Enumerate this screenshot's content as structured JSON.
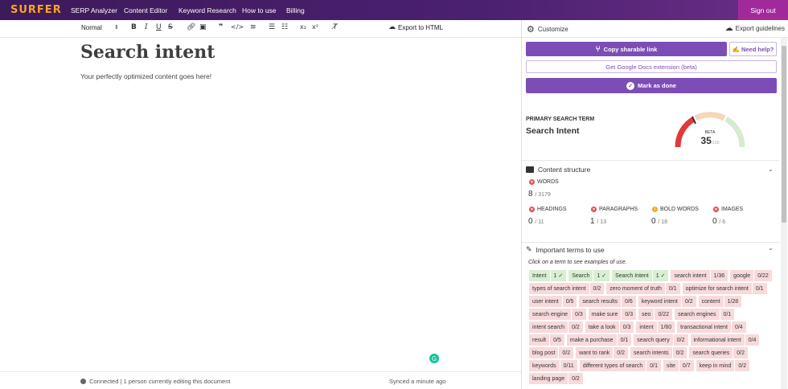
{
  "topbar": {
    "logo": "SURFER",
    "nav": [
      "SERP Analyzer",
      "Content Editor",
      "Keyword Research",
      "How to use",
      "Billing"
    ],
    "signout": "Sign out"
  },
  "toolbar": {
    "style_select": "Normal",
    "export_label": "Export to HTML"
  },
  "editor": {
    "title": "Search intent",
    "body": "Your perfectly optimized content goes here!"
  },
  "status": {
    "connection": "Connected | 1 person currently editing this document",
    "synced": "Synced a minute ago"
  },
  "panel": {
    "customize": "Customize",
    "export_guidelines": "Export guidelines",
    "copy_link": "Copy sharable link",
    "need_help": "Need help?",
    "gdocs": "Get Google Docs extension (beta)",
    "mark_done": "Mark as done",
    "primary_label": "PRIMARY SEARCH TERM",
    "primary_value": "Search Intent",
    "gauge": {
      "badge": "BETA",
      "score": "35",
      "max": "/100",
      "score_fraction": 0.35
    },
    "structure": {
      "title": "Content structure",
      "words_label": "WORDS",
      "words_value": "8",
      "words_target": "/ 3179",
      "metrics": [
        {
          "label": "HEADINGS",
          "value": "0",
          "target": "/ 11",
          "status": "red"
        },
        {
          "label": "PARAGRAPHS",
          "value": "1",
          "target": "/ 13",
          "status": "red"
        },
        {
          "label": "BOLD WORDS",
          "value": "0",
          "target": "/ 18",
          "status": "orange"
        },
        {
          "label": "IMAGES",
          "value": "0",
          "target": "/ 6",
          "status": "red"
        }
      ]
    },
    "terms": {
      "title": "Important terms to use",
      "hint": "Click on a term to see examples of use.",
      "items": [
        {
          "term": "Intent",
          "count": "1 ✓",
          "status": "green"
        },
        {
          "term": "Search",
          "count": "1 ✓",
          "status": "green"
        },
        {
          "term": "Search Intent",
          "count": "1 ✓",
          "status": "green"
        },
        {
          "term": "search intent",
          "count": "1/36",
          "status": "red"
        },
        {
          "term": "google",
          "count": "0/22",
          "status": "red"
        },
        {
          "term": "types of search intent",
          "count": "0/2",
          "status": "red"
        },
        {
          "term": "zero moment of truth",
          "count": "0/1",
          "status": "red"
        },
        {
          "term": "optimize for search intent",
          "count": "0/1",
          "status": "red"
        },
        {
          "term": "user intent",
          "count": "0/5",
          "status": "red"
        },
        {
          "term": "search results",
          "count": "0/6",
          "status": "red"
        },
        {
          "term": "keyword intent",
          "count": "0/2",
          "status": "red"
        },
        {
          "term": "content",
          "count": "1/28",
          "status": "red"
        },
        {
          "term": "search engine",
          "count": "0/3",
          "status": "red"
        },
        {
          "term": "make sure",
          "count": "0/3",
          "status": "red"
        },
        {
          "term": "seo",
          "count": "0/22",
          "status": "red"
        },
        {
          "term": "search engines",
          "count": "0/1",
          "status": "red"
        },
        {
          "term": "intent search",
          "count": "0/2",
          "status": "red"
        },
        {
          "term": "take a look",
          "count": "0/3",
          "status": "red"
        },
        {
          "term": "intent",
          "count": "1/60",
          "status": "red"
        },
        {
          "term": "transactional intent",
          "count": "0/4",
          "status": "red"
        },
        {
          "term": "result",
          "count": "0/5",
          "status": "red"
        },
        {
          "term": "make a purchase",
          "count": "0/1",
          "status": "red"
        },
        {
          "term": "search query",
          "count": "0/2",
          "status": "red"
        },
        {
          "term": "informational intent",
          "count": "0/4",
          "status": "red"
        },
        {
          "term": "blog post",
          "count": "0/2",
          "status": "red"
        },
        {
          "term": "want to rank",
          "count": "0/2",
          "status": "red"
        },
        {
          "term": "search intents",
          "count": "0/2",
          "status": "red"
        },
        {
          "term": "search queries",
          "count": "0/2",
          "status": "red"
        },
        {
          "term": "keywords",
          "count": "0/11",
          "status": "red"
        },
        {
          "term": "different types of search",
          "count": "0/1",
          "status": "red"
        },
        {
          "term": "site",
          "count": "0/7",
          "status": "red"
        },
        {
          "term": "keep in mind",
          "count": "0/2",
          "status": "red"
        },
        {
          "term": "landing page",
          "count": "0/2",
          "status": "red"
        }
      ]
    }
  }
}
